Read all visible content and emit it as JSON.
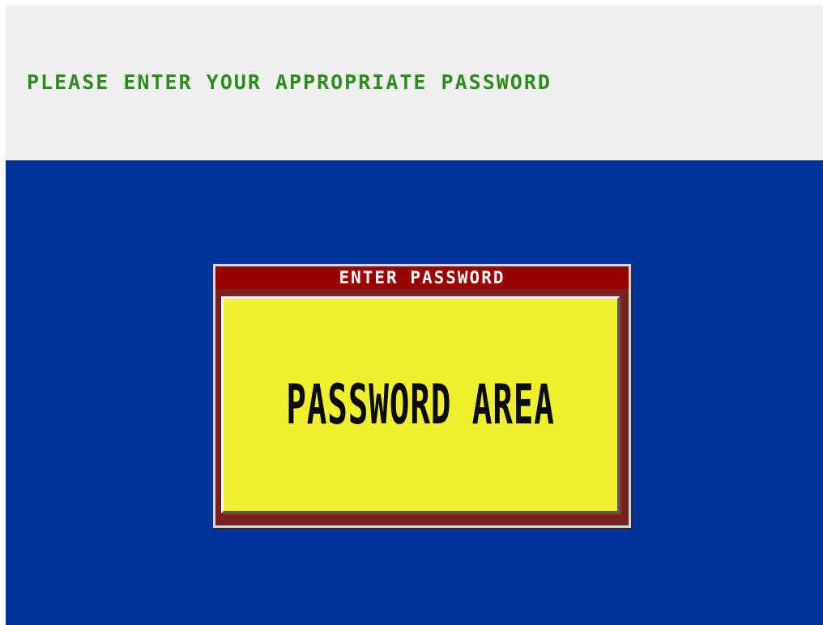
{
  "banner": {
    "instruction": "PLEASE ENTER YOUR APPROPRIATE PASSWORD"
  },
  "dialog": {
    "title": "ENTER PASSWORD",
    "field_label": "PASSWORD AREA"
  },
  "colors": {
    "banner_background": "#f0f0f0",
    "banner_text": "#2e8b1e",
    "main_background": "#003399",
    "dialog_title_bar": "#990000",
    "dialog_title_text": "#ffffff",
    "password_area": "#f0f02e",
    "password_text": "#0a0a0a"
  }
}
